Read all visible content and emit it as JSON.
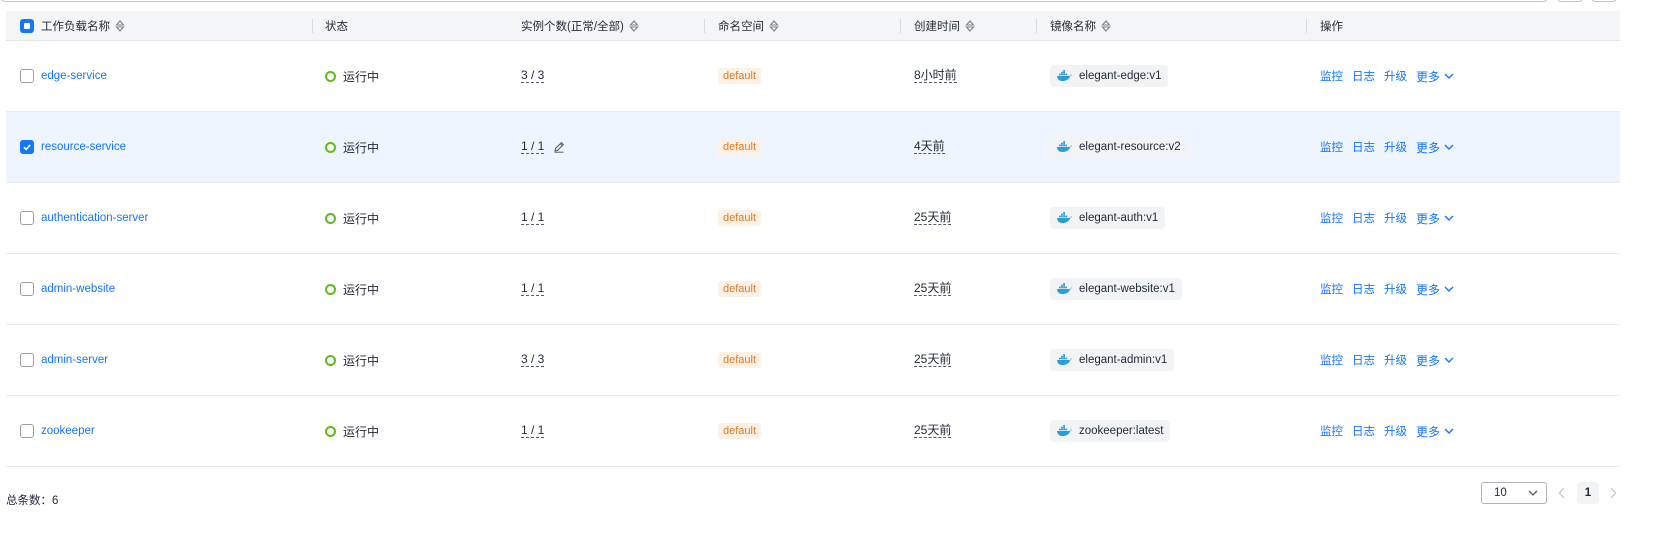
{
  "header": {
    "name": "工作负载名称",
    "status": "状态",
    "instances": "实例个数(正常/全部)",
    "namespace": "命名空间",
    "created": "创建时间",
    "image": "镜像名称",
    "ops": "操作"
  },
  "rows": [
    {
      "name": "edge-service",
      "status": "运行中",
      "instances": "3 / 3",
      "namespace": "default",
      "created": "8小时前",
      "image": "elegant-edge:v1",
      "selected": false
    },
    {
      "name": "resource-service",
      "status": "运行中",
      "instances": "1 / 1",
      "namespace": "default",
      "created": "4天前",
      "image": "elegant-resource:v2",
      "selected": true
    },
    {
      "name": "authentication-server",
      "status": "运行中",
      "instances": "1 / 1",
      "namespace": "default",
      "created": "25天前",
      "image": "elegant-auth:v1",
      "selected": false
    },
    {
      "name": "admin-website",
      "status": "运行中",
      "instances": "1 / 1",
      "namespace": "default",
      "created": "25天前",
      "image": "elegant-website:v1",
      "selected": false
    },
    {
      "name": "admin-server",
      "status": "运行中",
      "instances": "3 / 3",
      "namespace": "default",
      "created": "25天前",
      "image": "elegant-admin:v1",
      "selected": false
    },
    {
      "name": "zookeeper",
      "status": "运行中",
      "instances": "1 / 1",
      "namespace": "default",
      "created": "25天前",
      "image": "zookeeper:latest",
      "selected": false
    }
  ],
  "actions": {
    "monitor": "监控",
    "log": "日志",
    "upgrade": "升级",
    "more": "更多"
  },
  "footer": {
    "total": "总条数：6",
    "page_size": "10",
    "current_page": "1"
  },
  "colors": {
    "link": "#1476ff",
    "running": "#5ebc1a",
    "tag_text": "#e07b25",
    "tag_bg": "#fdf1e6",
    "selected_row": "#eef5ff"
  },
  "icons": {
    "sort": "sort-icon",
    "docker": "docker-icon",
    "edit": "edit-icon",
    "chevron": "chevron-down-icon"
  }
}
